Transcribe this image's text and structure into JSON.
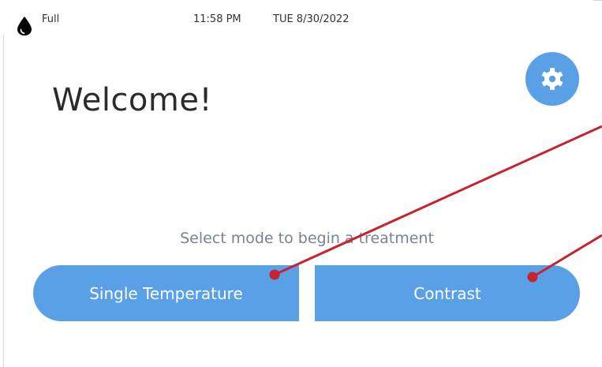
{
  "status_bar": {
    "level_icon": "water-drop-icon",
    "level_label": "Full",
    "time": "11:58 PM",
    "date": "TUE 8/30/2022"
  },
  "main": {
    "title": "Welcome!",
    "prompt": "Select mode to begin a treatment",
    "settings_icon": "gear-icon"
  },
  "modes": {
    "single_label": "Single Temperature",
    "contrast_label": "Contrast"
  },
  "colors": {
    "accent": "#5aa0e6",
    "callout": "#c8232c"
  }
}
